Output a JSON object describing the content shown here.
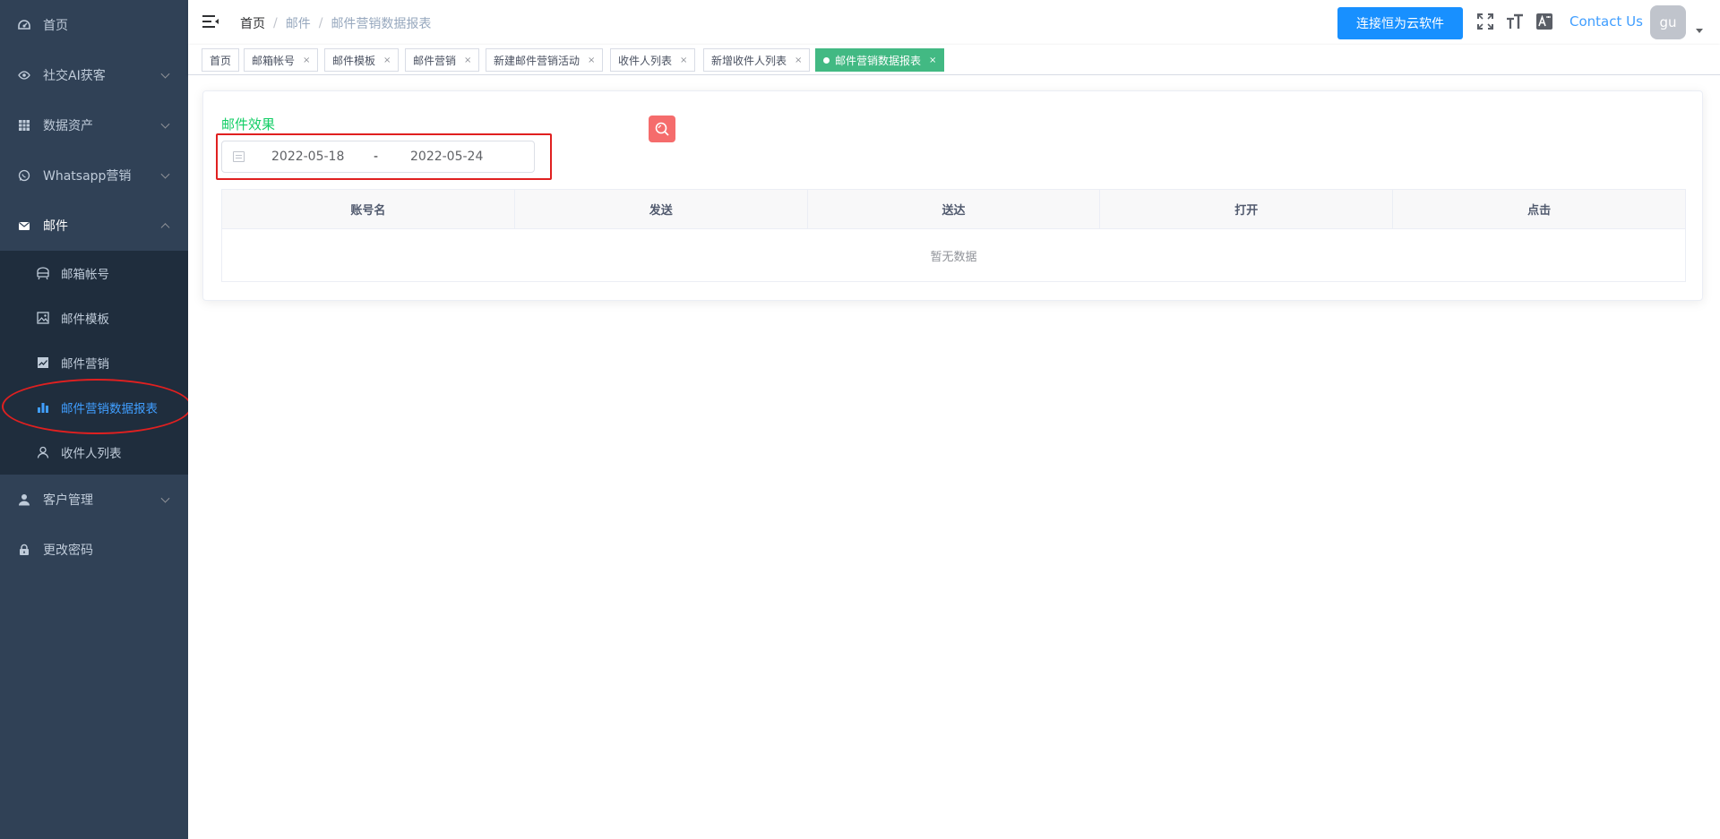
{
  "sidebar": {
    "items": [
      {
        "label": "首页",
        "icon": "dashboard-icon"
      },
      {
        "label": "社交AI获客",
        "icon": "eye-icon"
      },
      {
        "label": "数据资产",
        "icon": "table-icon"
      },
      {
        "label": "Whatsapp营销",
        "icon": "whatsapp-icon"
      },
      {
        "label": "邮件",
        "icon": "mail-icon"
      },
      {
        "label": "客户管理",
        "icon": "user-icon"
      },
      {
        "label": "更改密码",
        "icon": "lock-icon"
      }
    ],
    "mail_submenu": [
      {
        "label": "邮箱帐号",
        "icon": "mailbox-icon"
      },
      {
        "label": "邮件模板",
        "icon": "image-icon"
      },
      {
        "label": "邮件营销",
        "icon": "line-chart-icon"
      },
      {
        "label": "邮件营销数据报表",
        "icon": "bar-chart-icon"
      },
      {
        "label": "收件人列表",
        "icon": "person-icon"
      }
    ],
    "active_item": "邮件营销数据报表"
  },
  "navbar": {
    "breadcrumb": [
      "首页",
      "邮件",
      "邮件营销数据报表"
    ],
    "cloud_button": "连接恒为云软件",
    "contact": "Contact Us",
    "avatar_text": "gu"
  },
  "tags": [
    {
      "label": "首页",
      "closable": false
    },
    {
      "label": "邮箱帐号",
      "closable": true
    },
    {
      "label": "邮件模板",
      "closable": true
    },
    {
      "label": "邮件营销",
      "closable": true
    },
    {
      "label": "新建邮件营销活动",
      "closable": true
    },
    {
      "label": "收件人列表",
      "closable": true
    },
    {
      "label": "新增收件人列表",
      "closable": true
    },
    {
      "label": "邮件营销数据报表",
      "closable": true,
      "active": true
    }
  ],
  "close_glyph": "×",
  "main": {
    "title": "邮件效果",
    "date_start": "2022-05-18",
    "date_separator": "-",
    "date_end": "2022-05-24",
    "table": {
      "columns": [
        "账号名",
        "发送",
        "送达",
        "打开",
        "点击"
      ],
      "empty_text": "暂无数据"
    }
  },
  "colors": {
    "sidebar_bg": "#304156",
    "submenu_bg": "#1f2d3d",
    "accent": "#409eff",
    "active_tag": "#42b983",
    "title_green": "#13ce66",
    "search_btn": "#f56c6c",
    "annotation_red": "#e02020"
  }
}
